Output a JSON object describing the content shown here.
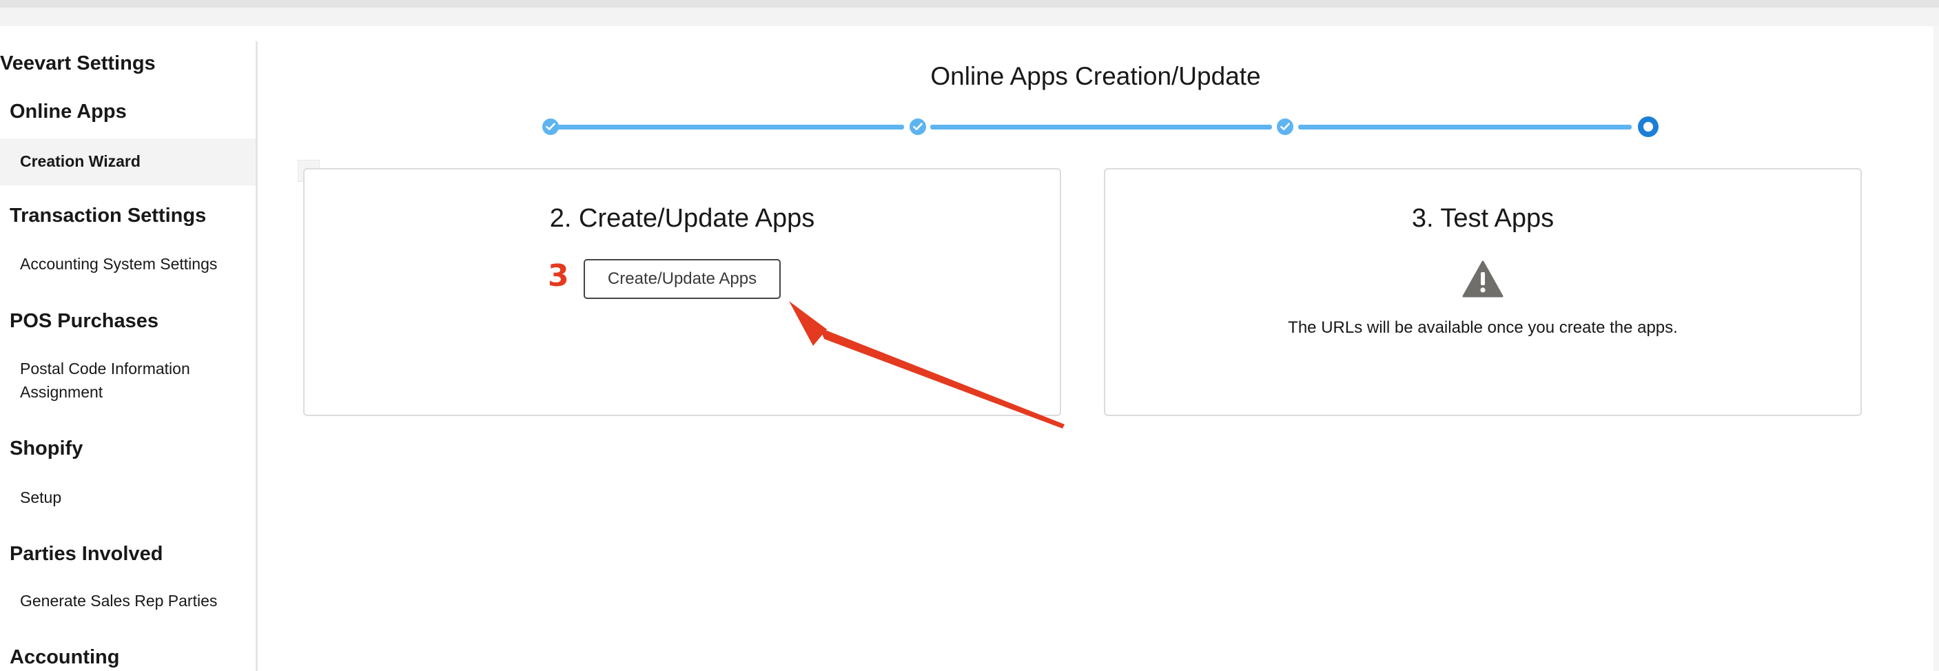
{
  "sidebar": {
    "title": "Veevart Settings",
    "sections": [
      {
        "heading": "Online Apps",
        "items": [
          {
            "label": "Creation Wizard",
            "active": true
          }
        ]
      },
      {
        "heading": "Transaction Settings",
        "items": [
          {
            "label": "Accounting System Settings"
          }
        ]
      },
      {
        "heading": "POS Purchases",
        "items": [
          {
            "label": "Postal Code Information Assignment"
          }
        ]
      },
      {
        "heading": "Shopify",
        "items": [
          {
            "label": "Setup"
          }
        ]
      },
      {
        "heading": "Parties Involved",
        "items": [
          {
            "label": "Generate Sales Rep Parties"
          }
        ]
      },
      {
        "heading": "Accounting",
        "items": []
      }
    ]
  },
  "wizard": {
    "title": "Online Apps Creation/Update",
    "progress": {
      "total_steps": 4,
      "completed_steps": 3,
      "current_step": 4
    },
    "cards": [
      {
        "title": "2. Create/Update Apps",
        "button_label": "Create/Update Apps"
      },
      {
        "title": "3. Test Apps",
        "icon": "warning-icon",
        "message": "The URLs will be available once you create the apps."
      }
    ]
  },
  "annotation": {
    "marker_label": "3",
    "color": "#e43a1f"
  },
  "colors": {
    "progress_complete": "#5eb4f0",
    "progress_current": "#1b7fd6",
    "card_border": "#dcdcdc",
    "active_nav_bg": "#f3f3f3"
  }
}
